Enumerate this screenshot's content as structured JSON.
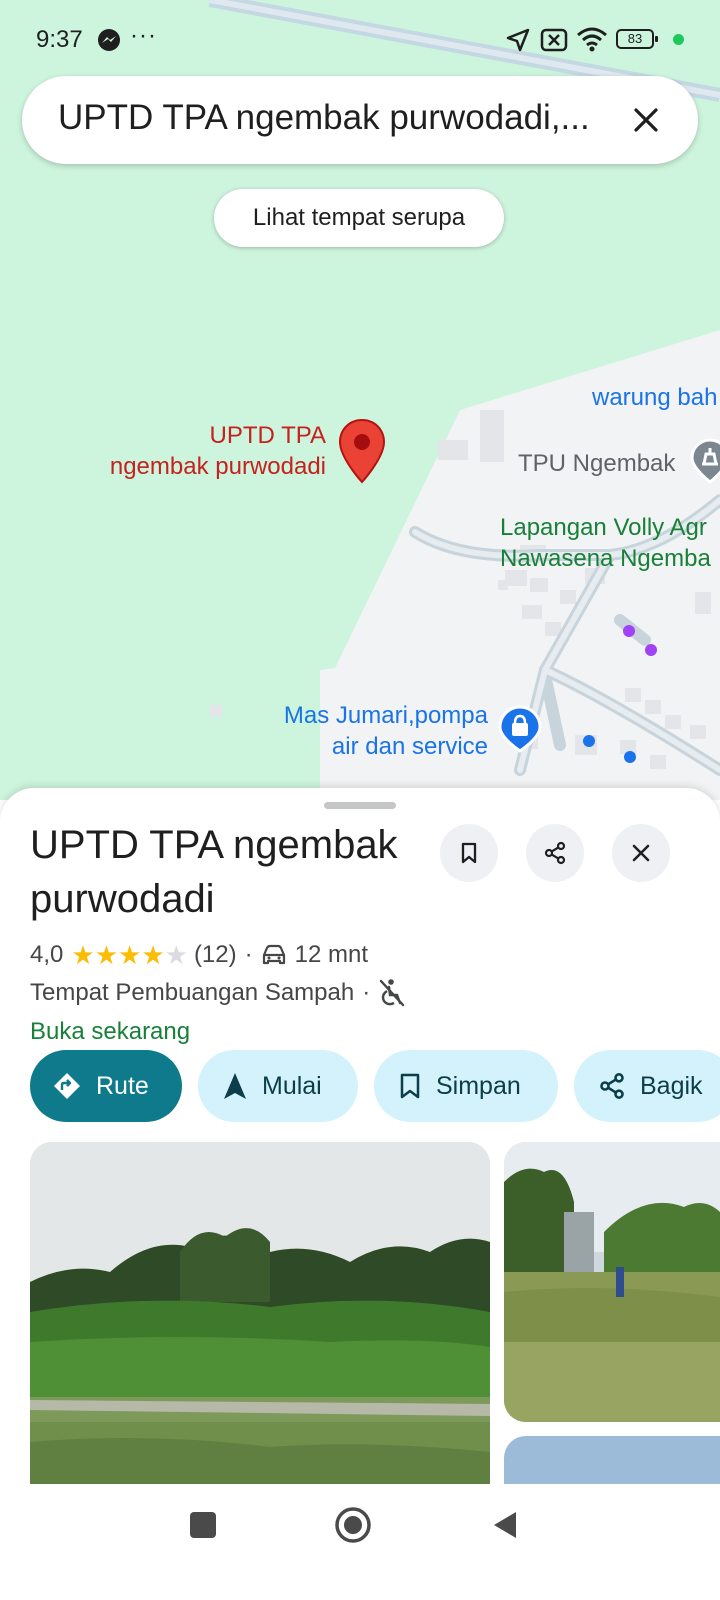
{
  "status_bar": {
    "time": "9:37",
    "more": "···",
    "battery": "83"
  },
  "search": {
    "query": "UPTD TPA ngembak purwodadi,..."
  },
  "map": {
    "similar_places_chip": "Lihat tempat serupa",
    "pin_label_line1": "UPTD TPA",
    "pin_label_line2": "ngembak purwodadi",
    "poi_warung": "warung bah",
    "poi_tpu": "TPU Ngembak",
    "poi_lapangan_line1": "Lapangan Volly Agr",
    "poi_lapangan_line2": "Nawasena Ngemba",
    "poi_masjumari_line1": "Mas Jumari,pompa",
    "poi_masjumari_line2": "air dan service"
  },
  "place": {
    "title": "UPTD TPA ngembak purwodadi",
    "rating": "4,0",
    "stars_filled": 4,
    "review_count": "(12)",
    "separator": "·",
    "drive_time": "12 mnt",
    "category": "Tempat Pembuangan Sampah",
    "open_status": "Buka sekarang"
  },
  "actions": {
    "directions": "Rute",
    "start": "Mulai",
    "save": "Simpan",
    "share": "Bagik"
  },
  "icons": {
    "search_clear": "close-icon",
    "save_place": "bookmark-icon",
    "share_place": "share-icon",
    "close_sheet": "close-icon",
    "pin": "map-pin-icon",
    "tpu": "cemetery-icon",
    "store": "shopping-bag-icon",
    "drive": "car-icon",
    "accessibility": "not-accessible-icon"
  },
  "colors": {
    "map_green": "#cdf4dc",
    "pin_red": "#ea4335",
    "primary_action": "#0e7a8b",
    "secondary_action": "#d3f2fb",
    "open_green": "#188038",
    "star": "#fbbc04"
  }
}
